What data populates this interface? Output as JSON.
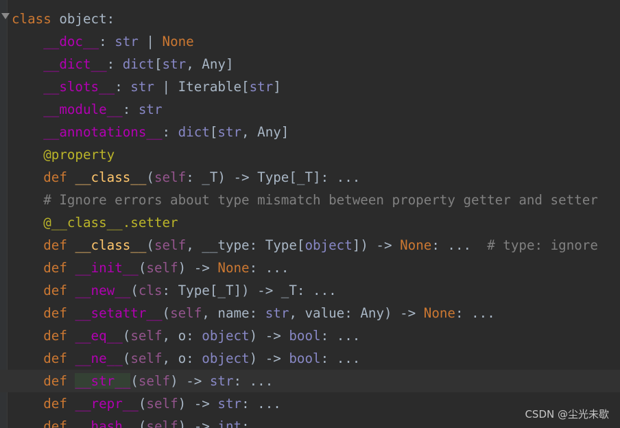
{
  "lines": [
    [
      {
        "t": "class ",
        "c": "kw"
      },
      {
        "t": "object:",
        "c": "plain"
      }
    ],
    [
      {
        "t": "    "
      },
      {
        "t": "__doc__",
        "c": "dunder"
      },
      {
        "t": ": ",
        "c": "plain"
      },
      {
        "t": "str",
        "c": "builtin"
      },
      {
        "t": " | ",
        "c": "plain"
      },
      {
        "t": "None",
        "c": "kw"
      }
    ],
    [
      {
        "t": "    "
      },
      {
        "t": "__dict__",
        "c": "dunder"
      },
      {
        "t": ": ",
        "c": "plain"
      },
      {
        "t": "dict",
        "c": "builtin"
      },
      {
        "t": "[",
        "c": "plain"
      },
      {
        "t": "str",
        "c": "builtin"
      },
      {
        "t": ", Any]",
        "c": "plain"
      }
    ],
    [
      {
        "t": "    "
      },
      {
        "t": "__slots__",
        "c": "dunder"
      },
      {
        "t": ": ",
        "c": "plain"
      },
      {
        "t": "str",
        "c": "builtin"
      },
      {
        "t": " | Iterable[",
        "c": "plain"
      },
      {
        "t": "str",
        "c": "builtin"
      },
      {
        "t": "]",
        "c": "plain"
      }
    ],
    [
      {
        "t": "    "
      },
      {
        "t": "__module__",
        "c": "dunder"
      },
      {
        "t": ": ",
        "c": "plain"
      },
      {
        "t": "str",
        "c": "builtin"
      }
    ],
    [
      {
        "t": "    "
      },
      {
        "t": "__annotations__",
        "c": "dunder"
      },
      {
        "t": ": ",
        "c": "plain"
      },
      {
        "t": "dict",
        "c": "builtin"
      },
      {
        "t": "[",
        "c": "plain"
      },
      {
        "t": "str",
        "c": "builtin"
      },
      {
        "t": ", Any]",
        "c": "plain"
      }
    ],
    [
      {
        "t": "    "
      },
      {
        "t": "@property",
        "c": "deco"
      }
    ],
    [
      {
        "t": "    "
      },
      {
        "t": "def ",
        "c": "kw"
      },
      {
        "t": "__class__",
        "c": "fn"
      },
      {
        "t": "(",
        "c": "plain"
      },
      {
        "t": "self",
        "c": "self"
      },
      {
        "t": ": _T) -> Type[_T]: ...",
        "c": "plain"
      }
    ],
    [
      {
        "t": "    "
      },
      {
        "t": "# Ignore errors about type mismatch between property getter and setter",
        "c": "comment"
      }
    ],
    [
      {
        "t": "    "
      },
      {
        "t": "@__class__.setter",
        "c": "deco"
      }
    ],
    [
      {
        "t": "    "
      },
      {
        "t": "def ",
        "c": "kw"
      },
      {
        "t": "__class__",
        "c": "fn"
      },
      {
        "t": "(",
        "c": "plain"
      },
      {
        "t": "self",
        "c": "self"
      },
      {
        "t": ", __type: Type[",
        "c": "plain"
      },
      {
        "t": "object",
        "c": "builtin"
      },
      {
        "t": "]) -> ",
        "c": "plain"
      },
      {
        "t": "None",
        "c": "kw"
      },
      {
        "t": ": ...  ",
        "c": "plain"
      },
      {
        "t": "# type: ignore",
        "c": "comment"
      }
    ],
    [
      {
        "t": "    "
      },
      {
        "t": "def ",
        "c": "kw"
      },
      {
        "t": "__init__",
        "c": "dunder"
      },
      {
        "t": "(",
        "c": "plain"
      },
      {
        "t": "self",
        "c": "self"
      },
      {
        "t": ") -> ",
        "c": "plain"
      },
      {
        "t": "None",
        "c": "kw"
      },
      {
        "t": ": ...",
        "c": "plain"
      }
    ],
    [
      {
        "t": "    "
      },
      {
        "t": "def ",
        "c": "kw"
      },
      {
        "t": "__new__",
        "c": "dunder"
      },
      {
        "t": "(",
        "c": "plain"
      },
      {
        "t": "cls",
        "c": "self"
      },
      {
        "t": ": Type[_T]) -> _T: ...",
        "c": "plain"
      }
    ],
    [
      {
        "t": "    "
      },
      {
        "t": "def ",
        "c": "kw"
      },
      {
        "t": "__setattr__",
        "c": "dunder"
      },
      {
        "t": "(",
        "c": "plain"
      },
      {
        "t": "self",
        "c": "self"
      },
      {
        "t": ", name: ",
        "c": "plain"
      },
      {
        "t": "str",
        "c": "builtin"
      },
      {
        "t": ", value: Any) -> ",
        "c": "plain"
      },
      {
        "t": "None",
        "c": "kw"
      },
      {
        "t": ": ...",
        "c": "plain"
      }
    ],
    [
      {
        "t": "    "
      },
      {
        "t": "def ",
        "c": "kw"
      },
      {
        "t": "__eq__",
        "c": "dunder"
      },
      {
        "t": "(",
        "c": "plain"
      },
      {
        "t": "self",
        "c": "self"
      },
      {
        "t": ", o: ",
        "c": "plain"
      },
      {
        "t": "object",
        "c": "builtin"
      },
      {
        "t": ") -> ",
        "c": "plain"
      },
      {
        "t": "bool",
        "c": "builtin"
      },
      {
        "t": ": ...",
        "c": "plain"
      }
    ],
    [
      {
        "t": "    "
      },
      {
        "t": "def ",
        "c": "kw"
      },
      {
        "t": "__ne__",
        "c": "dunder"
      },
      {
        "t": "(",
        "c": "plain"
      },
      {
        "t": "self",
        "c": "self"
      },
      {
        "t": ", o: ",
        "c": "plain"
      },
      {
        "t": "object",
        "c": "builtin"
      },
      {
        "t": ") -> ",
        "c": "plain"
      },
      {
        "t": "bool",
        "c": "builtin"
      },
      {
        "t": ": ...",
        "c": "plain"
      }
    ],
    [
      {
        "t": "    "
      },
      {
        "t": "def ",
        "c": "kw"
      },
      {
        "t": "__str__",
        "c": "dunder"
      },
      {
        "t": "(",
        "c": "plain"
      },
      {
        "t": "self",
        "c": "self"
      },
      {
        "t": ") -> ",
        "c": "plain"
      },
      {
        "t": "str",
        "c": "builtin"
      },
      {
        "t": ": ...",
        "c": "plain"
      }
    ],
    [
      {
        "t": "    "
      },
      {
        "t": "def ",
        "c": "kw"
      },
      {
        "t": "__repr__",
        "c": "dunder"
      },
      {
        "t": "(",
        "c": "plain"
      },
      {
        "t": "self",
        "c": "self"
      },
      {
        "t": ") -> ",
        "c": "plain"
      },
      {
        "t": "str",
        "c": "builtin"
      },
      {
        "t": ": ...",
        "c": "plain"
      }
    ],
    [
      {
        "t": "    "
      },
      {
        "t": "def ",
        "c": "kw"
      },
      {
        "t": "__hash__",
        "c": "dunder"
      },
      {
        "t": "(",
        "c": "plain"
      },
      {
        "t": "self",
        "c": "self"
      },
      {
        "t": ") -> ",
        "c": "plain"
      },
      {
        "t": "int",
        "c": "builtin"
      },
      {
        "t": ": ...",
        "c": "plain"
      }
    ]
  ],
  "current_line": 16,
  "watermark": "CSDN @尘光未歇"
}
